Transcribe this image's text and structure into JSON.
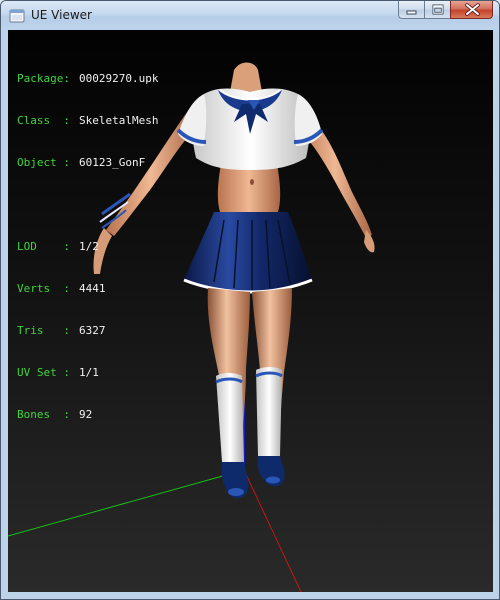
{
  "window": {
    "title": "UE Viewer",
    "controls": {
      "minimize_icon": "minimize-icon",
      "maximize_icon": "maximize-icon",
      "close_icon": "close-icon"
    }
  },
  "info": {
    "package": {
      "key": "Package:",
      "value": "00029270.upk"
    },
    "class": {
      "key": "Class  :",
      "value": "SkeletalMesh"
    },
    "object": {
      "key": "Object :",
      "value": "60123_GonF"
    },
    "lod": {
      "key": "LOD    :",
      "value": "1/2"
    },
    "verts": {
      "key": "Verts  :",
      "value": "4441"
    },
    "tris": {
      "key": "Tris   :",
      "value": "6327"
    },
    "uvset": {
      "key": "UV Set :",
      "value": "1/1"
    },
    "bones": {
      "key": "Bones  :",
      "value": "92"
    }
  },
  "colors": {
    "label_green": "#3ed43e",
    "value_white": "#f2f2f2",
    "axis_x": "#c01818",
    "axis_y": "#18c018",
    "axis_z": "#1818c0",
    "uniform_blue": "#102a6e",
    "uniform_white": "#f4f4f4",
    "skin": "#d89a72"
  }
}
